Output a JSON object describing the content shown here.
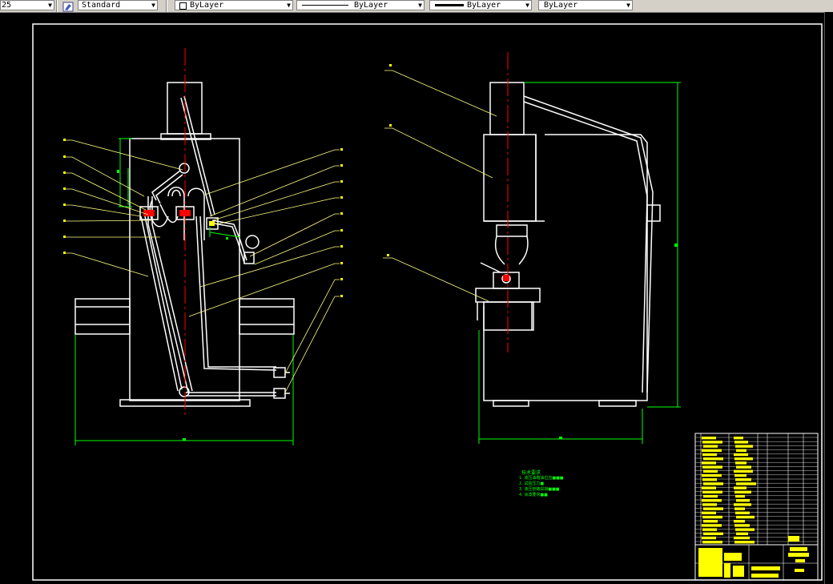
{
  "toolbar": {
    "scale_value": "25",
    "textstyle_value": "Standard",
    "layer_value": "ByLayer",
    "linetype_value": "ByLayer",
    "lineweight_value": "ByLayer",
    "plotstyle_value": "ByLayer"
  },
  "notes": {
    "title": "技术要求",
    "lines": [
      "1. 液压油箱油位应■■■",
      "2. 试验压力■",
      "3. 液压管路焊接■■■",
      "4. 涂漆要求■■"
    ]
  },
  "colors": {
    "background": "#000000",
    "geometry": "#ffffff",
    "centerline": "#ff0000",
    "dimension": "#00ff00",
    "leader": "#ffff80",
    "titleblock_fill": "#ffff00",
    "toolbar_face": "#d4d0c8"
  },
  "icons": {
    "textstyle": "text-style-icon",
    "dropdown": "chevron-down-icon"
  }
}
